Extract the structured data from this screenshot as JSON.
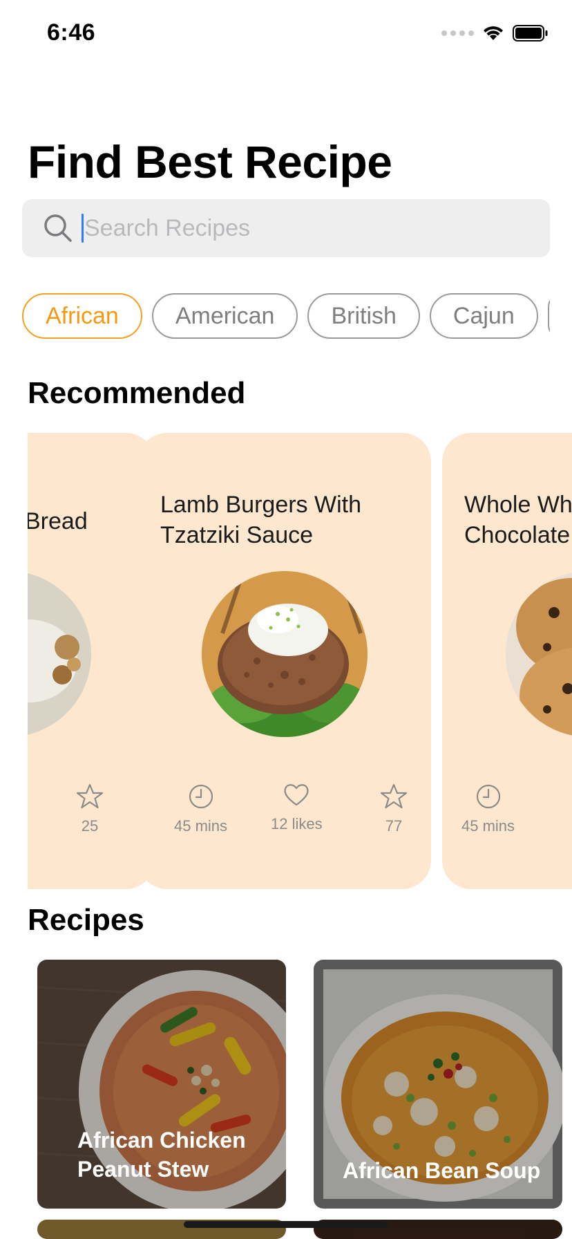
{
  "status_bar": {
    "time": "6:46"
  },
  "header": {
    "title": "Find Best Recipe"
  },
  "search": {
    "placeholder": "Search Recipes",
    "value": ""
  },
  "categories": {
    "items": [
      "African",
      "American",
      "British",
      "Cajun"
    ],
    "selected": "African"
  },
  "recommended": {
    "heading": "Recommended",
    "cards": [
      {
        "title": "Bread",
        "rating": "25"
      },
      {
        "title": "Lamb Burgers With Tzatziki Sauce",
        "time": "45 mins",
        "likes": "12 likes",
        "rating": "77"
      },
      {
        "title": "Whole Wh Chocolate",
        "time": "45 mins"
      }
    ]
  },
  "recipes": {
    "heading": "Recipes",
    "items": [
      {
        "name": "African Chicken Peanut Stew"
      },
      {
        "name": "African Bean Soup"
      }
    ]
  },
  "colors": {
    "accent": "#f59a10",
    "card_bg": "#fde8cf",
    "search_bg": "#eeeeef",
    "caret": "#2f7bf5"
  }
}
